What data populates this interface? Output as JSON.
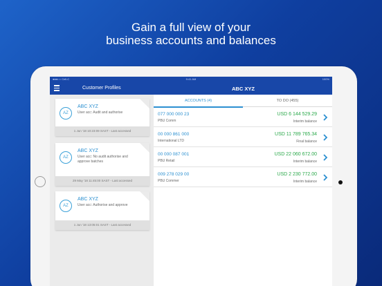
{
  "headline": {
    "line1": "Gain a full view of your",
    "line2": "business accounts and balances"
  },
  "statusbar": {
    "carrier": "●●●○○ Cell-C",
    "time": "9:41 AM",
    "battery": "100%"
  },
  "navbar": {
    "left_title": "Customer Profiles",
    "center_title": "ABC XYZ"
  },
  "profiles": [
    {
      "initials": "AZ",
      "name": "ABC XYZ",
      "desc": "User acc: Audit and authorise",
      "last_accessed": "1 Jun '18 10:23:09 SAST - Last accessed"
    },
    {
      "initials": "AZ",
      "name": "ABC XYZ",
      "desc": "User acc: No audit authorise and approve batches",
      "last_accessed": "29 May '18 11:45:00 SAST - Last accessed"
    },
    {
      "initials": "AZ",
      "name": "ABC XYZ",
      "desc": "User acc: Authorise and approve",
      "last_accessed": "1 Jun '18 13:05:01 SAST - Last accessed"
    }
  ],
  "tabs": [
    {
      "label": "ACCOUNTS (4)"
    },
    {
      "label": "TO DO (455)"
    }
  ],
  "accounts": [
    {
      "number": "077 000 000 23",
      "name": "PBU Comm",
      "amount": "USD 6 144 529.29",
      "balance_type": "Interim balance"
    },
    {
      "number": "00 000 861 000",
      "name": "International LTD",
      "amount": "USD 11 789 765.34",
      "balance_type": "Final balance"
    },
    {
      "number": "00 000 087 001",
      "name": "PBU Retail",
      "amount": "USD 22 060 672.00",
      "balance_type": "Interim balance"
    },
    {
      "number": "009 278 029 00",
      "name": "PBU Commer",
      "amount": "USD 2 230 772.00",
      "balance_type": "Interim balance"
    }
  ],
  "colors": {
    "accent": "#2a8fd0",
    "navbar": "#1847a8",
    "positive_amount": "#2aa84a"
  },
  "icons": {
    "menu": "hamburger-menu-icon",
    "chevron": "chevron-right-icon"
  }
}
